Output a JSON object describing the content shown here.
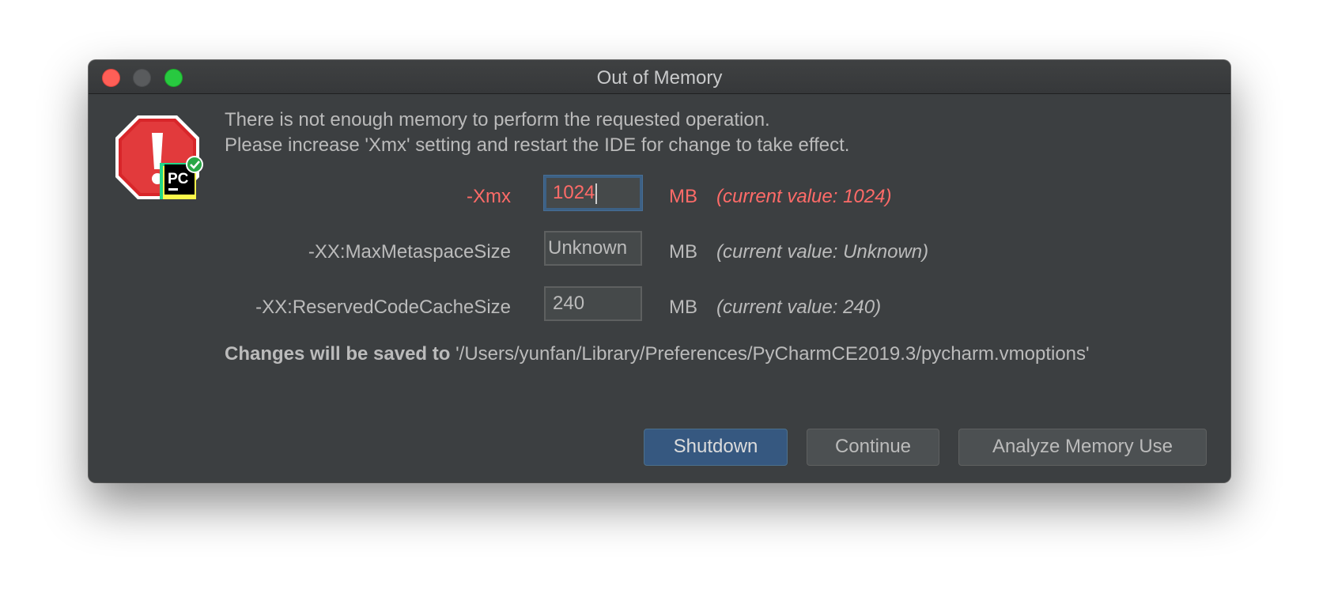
{
  "window": {
    "title": "Out of Memory"
  },
  "dialog": {
    "icon": "error-stop-sign-with-pycharm-badge",
    "message_line1": "There is not enough memory to perform the requested operation.",
    "message_line2": "Please increase 'Xmx' setting and restart the IDE for change to take effect.",
    "settings": [
      {
        "label": "-Xmx",
        "value": "1024",
        "unit": "MB",
        "current": "(current value: 1024)",
        "state": "error"
      },
      {
        "label": "-XX:MaxMetaspaceSize",
        "value": "Unknown",
        "unit": "MB",
        "current": "(current value: Unknown)",
        "state": "normal"
      },
      {
        "label": "-XX:ReservedCodeCacheSize",
        "value": "240",
        "unit": "MB",
        "current": "(current value: 240)",
        "state": "normal"
      }
    ],
    "saved_prefix": "Changes will be saved to",
    "saved_path": "'/Users/yunfan/Library/Preferences/PyCharmCE2019.3/pycharm.vmoptions'"
  },
  "buttons": {
    "shutdown": "Shutdown",
    "continue": "Continue",
    "analyze": "Analyze Memory Use"
  },
  "colors": {
    "background": "#3c3f41",
    "text": "#bbbbbb",
    "error": "#ff6b68",
    "default_button": "#365880",
    "focus_border": "#3d6185"
  }
}
